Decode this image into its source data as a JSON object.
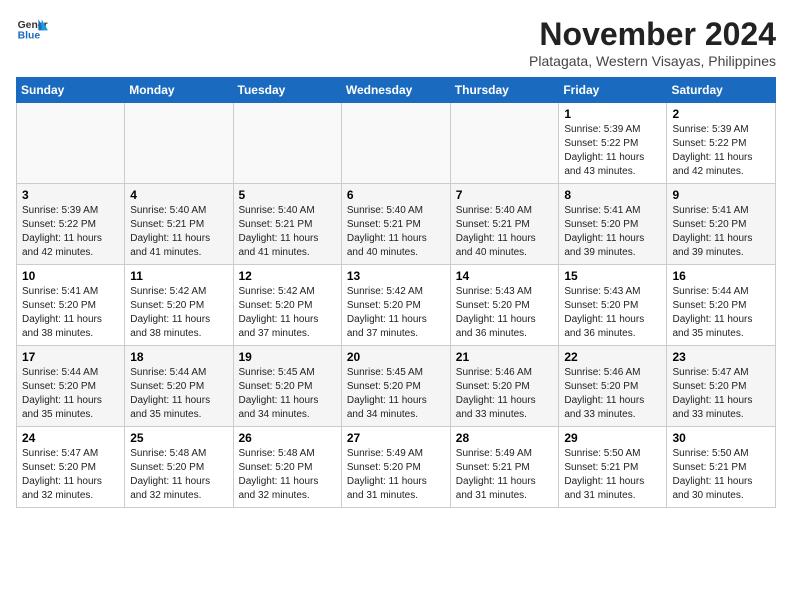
{
  "header": {
    "logo_general": "General",
    "logo_blue": "Blue",
    "month": "November 2024",
    "location": "Platagata, Western Visayas, Philippines"
  },
  "weekdays": [
    "Sunday",
    "Monday",
    "Tuesday",
    "Wednesday",
    "Thursday",
    "Friday",
    "Saturday"
  ],
  "weeks": [
    [
      {
        "day": "",
        "info": ""
      },
      {
        "day": "",
        "info": ""
      },
      {
        "day": "",
        "info": ""
      },
      {
        "day": "",
        "info": ""
      },
      {
        "day": "",
        "info": ""
      },
      {
        "day": "1",
        "info": "Sunrise: 5:39 AM\nSunset: 5:22 PM\nDaylight: 11 hours\nand 43 minutes."
      },
      {
        "day": "2",
        "info": "Sunrise: 5:39 AM\nSunset: 5:22 PM\nDaylight: 11 hours\nand 42 minutes."
      }
    ],
    [
      {
        "day": "3",
        "info": "Sunrise: 5:39 AM\nSunset: 5:22 PM\nDaylight: 11 hours\nand 42 minutes."
      },
      {
        "day": "4",
        "info": "Sunrise: 5:40 AM\nSunset: 5:21 PM\nDaylight: 11 hours\nand 41 minutes."
      },
      {
        "day": "5",
        "info": "Sunrise: 5:40 AM\nSunset: 5:21 PM\nDaylight: 11 hours\nand 41 minutes."
      },
      {
        "day": "6",
        "info": "Sunrise: 5:40 AM\nSunset: 5:21 PM\nDaylight: 11 hours\nand 40 minutes."
      },
      {
        "day": "7",
        "info": "Sunrise: 5:40 AM\nSunset: 5:21 PM\nDaylight: 11 hours\nand 40 minutes."
      },
      {
        "day": "8",
        "info": "Sunrise: 5:41 AM\nSunset: 5:20 PM\nDaylight: 11 hours\nand 39 minutes."
      },
      {
        "day": "9",
        "info": "Sunrise: 5:41 AM\nSunset: 5:20 PM\nDaylight: 11 hours\nand 39 minutes."
      }
    ],
    [
      {
        "day": "10",
        "info": "Sunrise: 5:41 AM\nSunset: 5:20 PM\nDaylight: 11 hours\nand 38 minutes."
      },
      {
        "day": "11",
        "info": "Sunrise: 5:42 AM\nSunset: 5:20 PM\nDaylight: 11 hours\nand 38 minutes."
      },
      {
        "day": "12",
        "info": "Sunrise: 5:42 AM\nSunset: 5:20 PM\nDaylight: 11 hours\nand 37 minutes."
      },
      {
        "day": "13",
        "info": "Sunrise: 5:42 AM\nSunset: 5:20 PM\nDaylight: 11 hours\nand 37 minutes."
      },
      {
        "day": "14",
        "info": "Sunrise: 5:43 AM\nSunset: 5:20 PM\nDaylight: 11 hours\nand 36 minutes."
      },
      {
        "day": "15",
        "info": "Sunrise: 5:43 AM\nSunset: 5:20 PM\nDaylight: 11 hours\nand 36 minutes."
      },
      {
        "day": "16",
        "info": "Sunrise: 5:44 AM\nSunset: 5:20 PM\nDaylight: 11 hours\nand 35 minutes."
      }
    ],
    [
      {
        "day": "17",
        "info": "Sunrise: 5:44 AM\nSunset: 5:20 PM\nDaylight: 11 hours\nand 35 minutes."
      },
      {
        "day": "18",
        "info": "Sunrise: 5:44 AM\nSunset: 5:20 PM\nDaylight: 11 hours\nand 35 minutes."
      },
      {
        "day": "19",
        "info": "Sunrise: 5:45 AM\nSunset: 5:20 PM\nDaylight: 11 hours\nand 34 minutes."
      },
      {
        "day": "20",
        "info": "Sunrise: 5:45 AM\nSunset: 5:20 PM\nDaylight: 11 hours\nand 34 minutes."
      },
      {
        "day": "21",
        "info": "Sunrise: 5:46 AM\nSunset: 5:20 PM\nDaylight: 11 hours\nand 33 minutes."
      },
      {
        "day": "22",
        "info": "Sunrise: 5:46 AM\nSunset: 5:20 PM\nDaylight: 11 hours\nand 33 minutes."
      },
      {
        "day": "23",
        "info": "Sunrise: 5:47 AM\nSunset: 5:20 PM\nDaylight: 11 hours\nand 33 minutes."
      }
    ],
    [
      {
        "day": "24",
        "info": "Sunrise: 5:47 AM\nSunset: 5:20 PM\nDaylight: 11 hours\nand 32 minutes."
      },
      {
        "day": "25",
        "info": "Sunrise: 5:48 AM\nSunset: 5:20 PM\nDaylight: 11 hours\nand 32 minutes."
      },
      {
        "day": "26",
        "info": "Sunrise: 5:48 AM\nSunset: 5:20 PM\nDaylight: 11 hours\nand 32 minutes."
      },
      {
        "day": "27",
        "info": "Sunrise: 5:49 AM\nSunset: 5:20 PM\nDaylight: 11 hours\nand 31 minutes."
      },
      {
        "day": "28",
        "info": "Sunrise: 5:49 AM\nSunset: 5:21 PM\nDaylight: 11 hours\nand 31 minutes."
      },
      {
        "day": "29",
        "info": "Sunrise: 5:50 AM\nSunset: 5:21 PM\nDaylight: 11 hours\nand 31 minutes."
      },
      {
        "day": "30",
        "info": "Sunrise: 5:50 AM\nSunset: 5:21 PM\nDaylight: 11 hours\nand 30 minutes."
      }
    ]
  ]
}
